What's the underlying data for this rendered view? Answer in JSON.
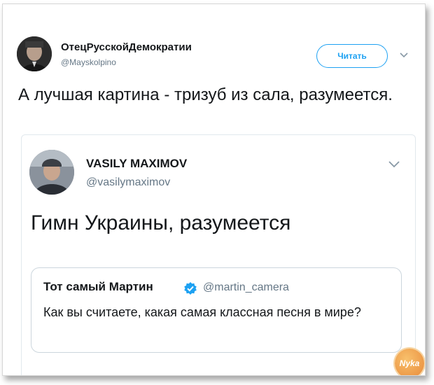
{
  "tweet": {
    "author_name": "ОтецРусскойДемократии",
    "author_handle": "@Mayskolpino",
    "follow_label": "Читать",
    "text": "А лучшая картина - тризуб из сала, разумеется."
  },
  "quoted_tweet": {
    "author_name": "VASILY MAXIMOV",
    "author_handle": "@vasilymaximov",
    "text": "Гимн Украины, разумеется",
    "nested": {
      "author_name": "Тот самый Мартин",
      "author_handle": "@martin_camera",
      "text": "Как вы считаете, какая самая классная песня в мире?"
    }
  },
  "watermark": "Nyka",
  "colors": {
    "accent": "#1da1f2",
    "muted": "#657786",
    "text": "#14171a"
  },
  "icons": {
    "verified": "verified-badge-icon",
    "more": "chevron-down-icon"
  }
}
